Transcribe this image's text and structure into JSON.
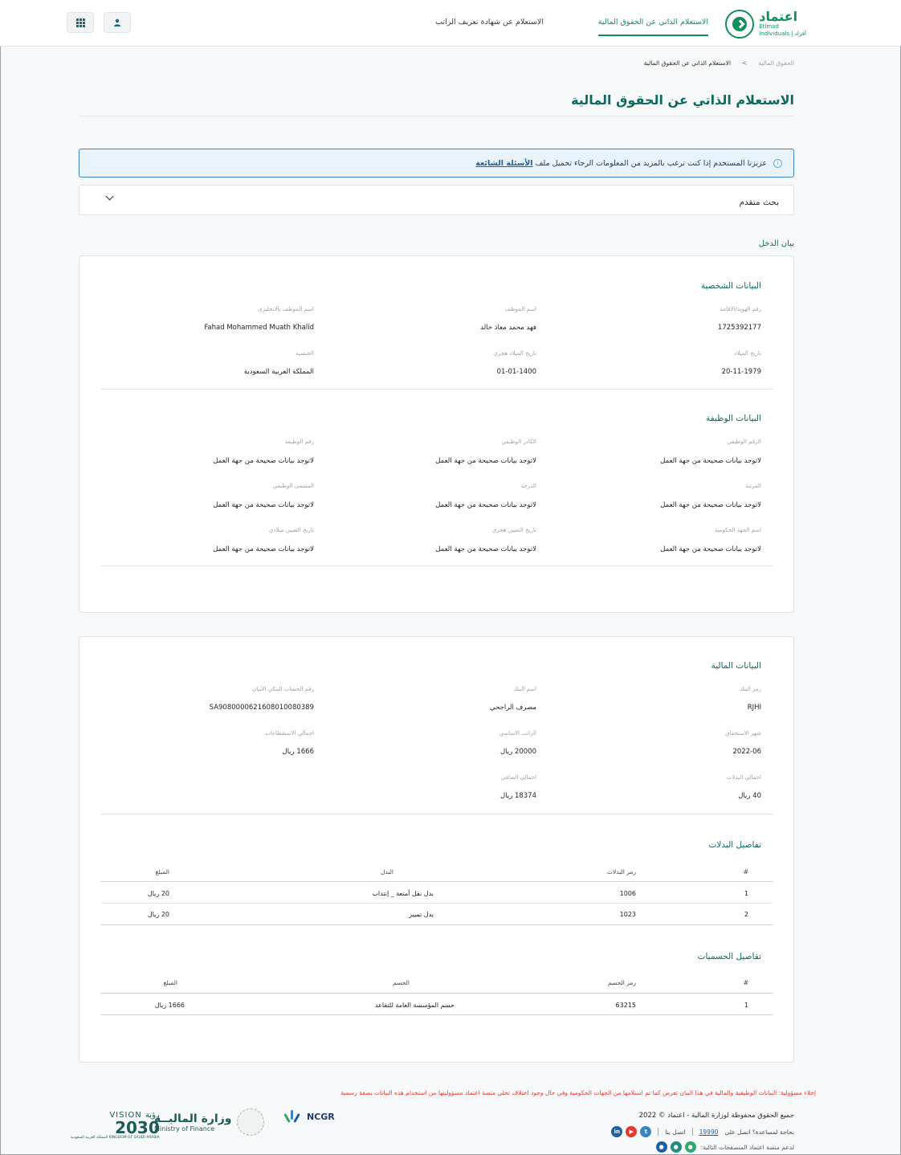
{
  "header": {
    "logo_ar": "اعتماد",
    "logo_en": "Etimad",
    "logo_sub": "Individuals | أفراد",
    "nav": [
      {
        "label": "الاستعلام الذاتي عن الحقوق المالية",
        "active": true
      },
      {
        "label": "الاستعلام عن شهادة تعريف الراتب",
        "active": false
      }
    ],
    "user_icon": "user-icon",
    "apps_icon": "apps-grid-icon"
  },
  "breadcrumb": {
    "root": "الحقوق المالية",
    "separator": ">",
    "current": "الاستعلام الذاتي عن الحقوق المالية"
  },
  "page_title": "الاستعلام الذاتي عن الحقوق المالية",
  "alert": {
    "text": "عزيزنا المستخدم إذا كنت ترغب بالمزيد من المعلومات الرجاء تحميل ملف",
    "link": "الأسئلة الشائعة"
  },
  "advanced_search": {
    "label": "بحث متقدم"
  },
  "income_heading": "بيان الدخل",
  "personal": {
    "title": "البيانات الشخصية",
    "fields": [
      {
        "label": "رقم الهوية/الاقامة",
        "value": "1725392177"
      },
      {
        "label": "اسم الموظف",
        "value": "فهد محمد معاذ خالد"
      },
      {
        "label": "اسم الموظف بالانجليزي",
        "value": "Fahad Mohammed Muath Khalid"
      },
      {
        "label": "تاريخ الميلاد",
        "value": "20-11-1979"
      },
      {
        "label": "تاريخ الميلاد هجري",
        "value": "01-01-1400"
      },
      {
        "label": "الجنسية",
        "value": "المملكة العربية السعودية"
      }
    ]
  },
  "job": {
    "title": "البيانات الوظيفة",
    "fields": [
      {
        "label": "الرقم الوظيفي",
        "value": "لاتوجد بيانات صحيحة من جهة العمل"
      },
      {
        "label": "الكادر الوظيفي",
        "value": "لاتوجد بيانات صحيحة من جهة العمل"
      },
      {
        "label": "رقم الوظيفة",
        "value": "لاتوجد بيانات صحيحة من جهة العمل"
      },
      {
        "label": "المرتبة",
        "value": "لاتوجد بيانات صحيحة من جهة العمل"
      },
      {
        "label": "الدرجة",
        "value": "لاتوجد بيانات صحيحة من جهة العمل"
      },
      {
        "label": "المسمى الوظيفي",
        "value": "لاتوجد بيانات صحيحة من جهة العمل"
      },
      {
        "label": "اسم الجهة الحكومية",
        "value": "لاتوجد بيانات صحيحة من جهة العمل"
      },
      {
        "label": "تاريخ التعيين هجري",
        "value": "لاتوجد بيانات صحيحة من جهة العمل"
      },
      {
        "label": "تاريخ التعيين ميلادي",
        "value": "لاتوجد بيانات صحيحة من جهة العمل"
      }
    ]
  },
  "financial": {
    "title": "البيانات المالية",
    "fields": [
      {
        "label": "رمز البنك",
        "value": "RJHI"
      },
      {
        "label": "اسم البنك",
        "value": "مصرف الراجحي"
      },
      {
        "label": "رقم الحساب البنكي الآيبان",
        "value": "SA9080000621608010080389"
      },
      {
        "label": "شهر الاستحقاق",
        "value": "2022-06"
      },
      {
        "label": "الراتب الاساسي",
        "value": "20000 ريال"
      },
      {
        "label": "اجمالي الاستقطاعات",
        "value": "1666 ريال"
      },
      {
        "label": "اجمالي البدلات",
        "value": "40 ريال"
      },
      {
        "label": "اجمالي الصافي",
        "value": "18374 ريال"
      }
    ]
  },
  "allowances": {
    "title": "تفاصيل البدلات",
    "headers": [
      "#",
      "رمز البدلات",
      "البدل",
      "المبلغ"
    ],
    "rows": [
      [
        "1",
        "1006",
        "بدل نقل أمتعة _ إنتداب",
        "20 ريال"
      ],
      [
        "2",
        "1023",
        "بدل تمييز",
        "20 ريال"
      ]
    ]
  },
  "deductions": {
    "title": "تفاصيل الحسميات",
    "headers": [
      "#",
      "رمز الحسم",
      "الحسم",
      "المبلغ"
    ],
    "rows": [
      [
        "1",
        "63215",
        "حسم المؤسسة العامة للتقاعد",
        "1666 ريال"
      ]
    ]
  },
  "footer": {
    "disclaimer": "إخلاء مسؤولية: البيانات الوظيفية والمالية في هذا البيان تعرض كما تم استلامها من الجهات الحكومية وفي حال وجود اختلاف تخلي منصة اعتماد مسؤوليتها من استخدام هذه البيانات بصفة رسمية",
    "copyright": "جميع الحقوق محفوظة لوزارة المالية - اعتماد © 2022",
    "help_text": "بحاجة لمساعدة؟ اتصل على",
    "help_number": "19990",
    "contact": "اتصل بنا",
    "support_text": "لدعم منصة اعتماد المتصفحات التالية:",
    "ncgr": "NCGR",
    "mof_ar": "وزارة الماليــة",
    "mof_en": "Ministry of Finance",
    "vision_top": "VISION رؤية",
    "vision_year": "2030",
    "vision_sub": "المملكة العربية السعودية KINGDOM OF SAUDI ARABIA"
  },
  "colors": {
    "brand": "#0f8f5a",
    "title": "#0d6a5e",
    "alert_border": "#3a85c1",
    "disclaimer": "#e53b2f"
  }
}
